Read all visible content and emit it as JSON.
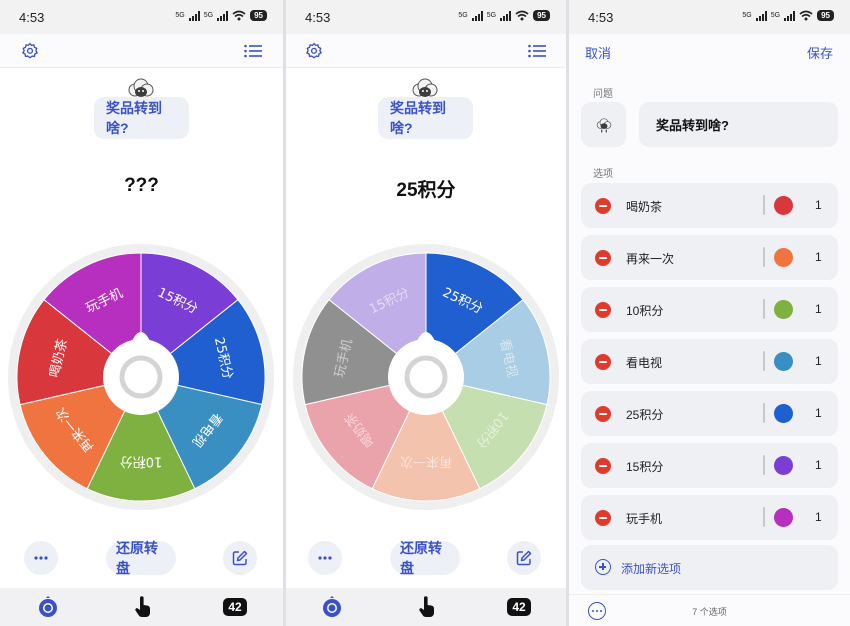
{
  "status": {
    "time": "4:53",
    "net1": "5G",
    "net2": "5G",
    "battery": "95"
  },
  "question": "奖品转到啥?",
  "screen1": {
    "result": "???"
  },
  "screen2": {
    "result": "25积分"
  },
  "bottom": {
    "reset_label": "还原转盘"
  },
  "tabbar": {
    "count": "42"
  },
  "editor": {
    "cancel": "取消",
    "save": "保存",
    "question_label": "问题",
    "options_label": "选项",
    "add_option": "添加新选项",
    "options_count": "7 个选项"
  },
  "options": [
    {
      "name": "喝奶茶",
      "weight": "1",
      "color": "#d8373b"
    },
    {
      "name": "再来一次",
      "weight": "1",
      "color": "#ef7440"
    },
    {
      "name": "10积分",
      "weight": "1",
      "color": "#7eb13f"
    },
    {
      "name": "看电视",
      "weight": "1",
      "color": "#3a8fc2"
    },
    {
      "name": "25积分",
      "weight": "1",
      "color": "#1f5fd0"
    },
    {
      "name": "15积分",
      "weight": "1",
      "color": "#7a3ed6"
    },
    {
      "name": "玩手机",
      "weight": "1",
      "color": "#b72fbf"
    }
  ],
  "wheel1": {
    "order": [
      "15积分",
      "25积分",
      "看电视",
      "10积分",
      "再来一次",
      "喝奶茶",
      "玩手机"
    ],
    "colors": [
      "#7a3ed6",
      "#1f5fd0",
      "#3a8fc2",
      "#7eb13f",
      "#ef7440",
      "#d8373b",
      "#b72fbf"
    ],
    "highlight": null
  },
  "wheel2": {
    "order": [
      "25积分",
      "看电视",
      "10积分",
      "再来一次",
      "喝奶茶",
      "玩手机",
      "15积分"
    ],
    "colors": [
      "#1f5fd0",
      "#a8cde4",
      "#c5dfb0",
      "#f4c3ad",
      "#eba3ab",
      "#909090",
      "#c0aee8"
    ],
    "highlight": "25积分"
  }
}
